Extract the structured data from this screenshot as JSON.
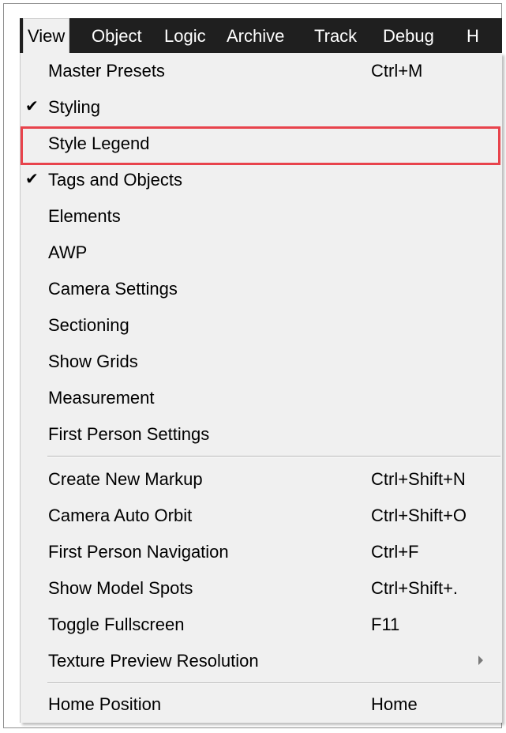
{
  "menubar": {
    "items": [
      {
        "label": "View",
        "active": true
      },
      {
        "label": "Object"
      },
      {
        "label": "Logic"
      },
      {
        "label": "Archive"
      },
      {
        "label": "Track"
      },
      {
        "label": "Debug"
      },
      {
        "label": "H"
      }
    ]
  },
  "view_menu": {
    "items": [
      {
        "label": "Master Presets",
        "shortcut": "Ctrl+M"
      },
      {
        "label": "Styling",
        "checked": true
      },
      {
        "label": "Style Legend",
        "annotated": true
      },
      {
        "label": "Tags and Objects",
        "checked": true
      },
      {
        "label": "Elements"
      },
      {
        "label": "AWP"
      },
      {
        "label": "Camera Settings"
      },
      {
        "label": "Sectioning"
      },
      {
        "label": "Show Grids"
      },
      {
        "label": "Measurement"
      },
      {
        "label": "First Person Settings"
      },
      {
        "label": "Create New Markup",
        "shortcut": "Ctrl+Shift+N"
      },
      {
        "label": "Camera Auto Orbit",
        "shortcut": "Ctrl+Shift+O"
      },
      {
        "label": "First Person Navigation",
        "shortcut": "Ctrl+F"
      },
      {
        "label": "Show Model Spots",
        "shortcut": "Ctrl+Shift+."
      },
      {
        "label": "Toggle Fullscreen",
        "shortcut": "F11"
      },
      {
        "label": "Texture Preview Resolution",
        "has_submenu": true
      },
      {
        "label": "Home Position",
        "shortcut": "Home"
      }
    ]
  },
  "colors": {
    "menubar_bg": "#1f1f1f",
    "menu_bg": "#f0f0f0",
    "annotation": "#e8434c"
  },
  "icons": {
    "check": "✔"
  }
}
